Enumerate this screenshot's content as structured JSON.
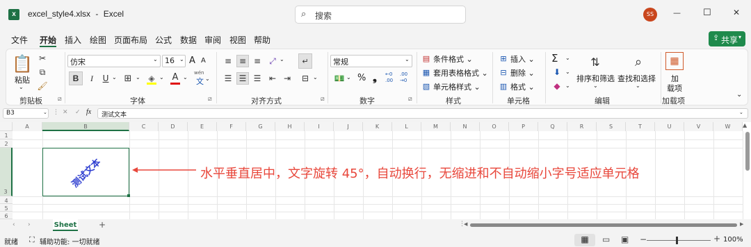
{
  "window": {
    "file_name": "excel_style4.xlsx",
    "separator": "-",
    "app_name": "Excel",
    "search_placeholder": "搜索",
    "user_initials": "SS",
    "minimize": "—",
    "maximize": "☐",
    "close": "✕"
  },
  "menu": {
    "items": [
      "文件",
      "开始",
      "插入",
      "绘图",
      "页面布局",
      "公式",
      "数据",
      "审阅",
      "视图",
      "帮助"
    ],
    "active_index": 1,
    "share_label": "共享"
  },
  "ribbon": {
    "clipboard": {
      "paste": "粘贴",
      "group": "剪贴板"
    },
    "font": {
      "name": "仿宋",
      "size": "16",
      "bold": "B",
      "italic": "I",
      "underline": "U",
      "grow": "A",
      "shrink": "A",
      "font_color_letter": "A",
      "wen": "wén",
      "wen_char": "文",
      "group": "字体"
    },
    "alignment": {
      "group": "对齐方式"
    },
    "number": {
      "format": "常规",
      "percent": "%",
      "comma": "❟",
      "inc_decimal": "←0 .00",
      "dec_decimal": ".00 →0",
      "group": "数字"
    },
    "styles": {
      "conditional": "条件格式",
      "table": "套用表格格式",
      "cell_styles": "单元格样式",
      "group": "样式"
    },
    "cells": {
      "insert": "插入",
      "delete": "删除",
      "format": "格式",
      "group": "单元格"
    },
    "editing": {
      "sum": "Σ",
      "sort_filter": "排序和筛选",
      "find_select": "查找和选择",
      "group": "编辑"
    },
    "addins": {
      "label_line1": "加",
      "label_line2": "载项",
      "group": "加载项"
    }
  },
  "formula_bar": {
    "name_box": "B3",
    "cancel": "✕",
    "enter": "✓",
    "fx": "fx",
    "value": "测试文本"
  },
  "sheet": {
    "columns": [
      "A",
      "B",
      "C",
      "D",
      "E",
      "F",
      "G",
      "H",
      "I",
      "J",
      "K",
      "L",
      "M",
      "N",
      "O",
      "P",
      "Q",
      "R",
      "S",
      "T",
      "U",
      "V",
      "W"
    ],
    "rows": [
      "1",
      "2",
      "3",
      "4",
      "5",
      "6"
    ],
    "cell_b3_text": "测试文本",
    "annotation": "水平垂直居中，文字旋转 45°，自动换行，无缩进和不自动缩小字号适应单元格"
  },
  "tabs": {
    "sheet_name": "Sheet",
    "add": "+"
  },
  "status": {
    "ready": "就绪",
    "accessibility": "辅助功能: 一切就绪",
    "zoom": "100%"
  },
  "colors": {
    "accent_green": "#1e7145",
    "share_green": "#1f8a4c",
    "avatar": "#c9461d",
    "annotation_red": "#e8473b",
    "rotated_text_blue": "#2f3fd0"
  }
}
